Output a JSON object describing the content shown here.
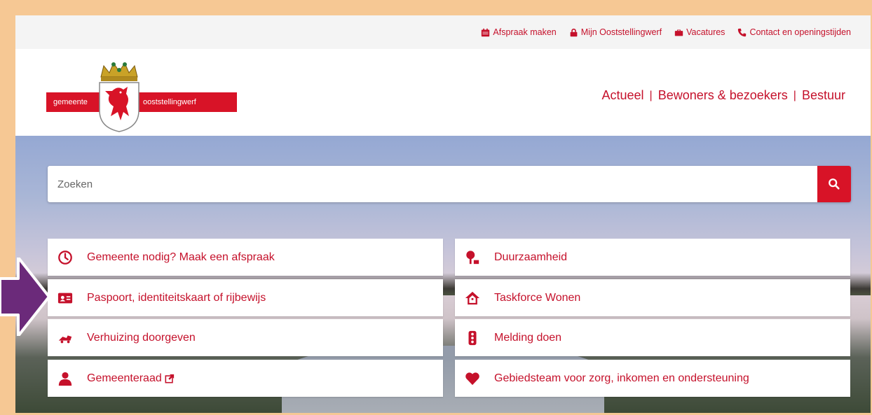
{
  "toplinks": [
    {
      "label": "Afspraak maken",
      "icon": "calendar-icon"
    },
    {
      "label": "Mijn Ooststellingwerf",
      "icon": "lock-icon"
    },
    {
      "label": "Vacatures",
      "icon": "briefcase-icon"
    },
    {
      "label": "Contact en openingstijden",
      "icon": "phone-icon"
    }
  ],
  "logo": {
    "left": "gemeente",
    "right": "ooststellingwerf"
  },
  "mainnav": [
    "Actueel",
    "Bewoners & bezoekers",
    "Bestuur"
  ],
  "search": {
    "placeholder": "Zoeken",
    "button_icon": "search-icon"
  },
  "tiles_left": [
    {
      "label": "Gemeente nodig? Maak een afspraak",
      "icon": "clock-icon"
    },
    {
      "label": "Paspoort, identiteitskaart of rijbewijs",
      "icon": "id-card-icon"
    },
    {
      "label": "Verhuizing doorgeven",
      "icon": "moving-truck-icon"
    },
    {
      "label": "Gemeenteraad",
      "icon": "person-icon",
      "external": true
    }
  ],
  "tiles_right": [
    {
      "label": "Duurzaamheid",
      "icon": "tree-icon"
    },
    {
      "label": "Taskforce Wonen",
      "icon": "house-icon"
    },
    {
      "label": "Melding doen",
      "icon": "traffic-light-icon"
    },
    {
      "label": "Gebiedsteam voor zorg, inkomen en ondersteuning",
      "icon": "heart-icon"
    }
  ],
  "colors": {
    "brand": "#c5112b",
    "frame": "#f6c894",
    "arrow": "#6b2a7a"
  }
}
